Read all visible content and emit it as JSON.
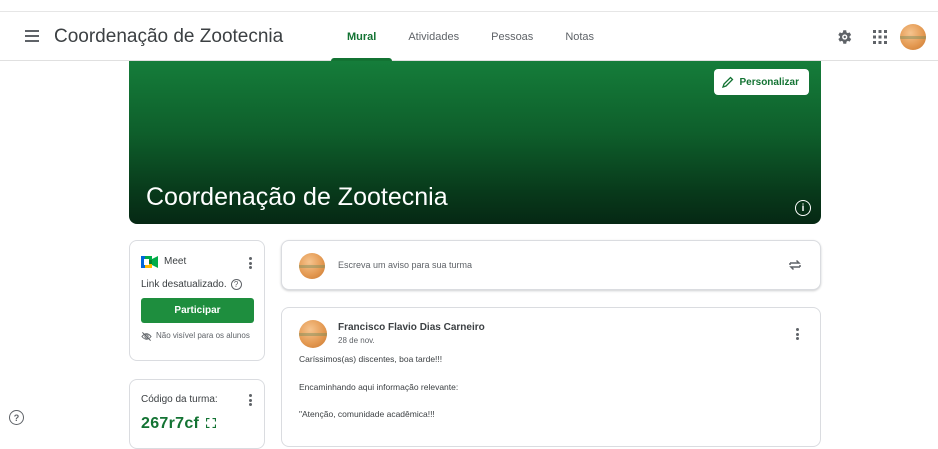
{
  "header": {
    "app_title": "Coordenação de Zootecnia",
    "tabs": [
      {
        "label": "Mural",
        "active": true
      },
      {
        "label": "Atividades",
        "active": false
      },
      {
        "label": "Pessoas",
        "active": false
      },
      {
        "label": "Notas",
        "active": false
      }
    ],
    "icons": [
      "menu-icon",
      "settings-icon",
      "apps-grid-icon",
      "account-avatar"
    ]
  },
  "banner": {
    "title": "Coordenação de Zootecnia",
    "customize_label": "Personalizar",
    "info_glyph": "i"
  },
  "meet": {
    "label": "Meet",
    "link_status": "Link desatualizado.",
    "join_label": "Participar",
    "visibility_note": "Não visível para os alunos"
  },
  "class_code": {
    "label": "Código da turma:",
    "value": "267r7cf"
  },
  "announce": {
    "placeholder": "Escreva um aviso para sua turma"
  },
  "post": {
    "author": "Francisco Flavio Dias Carneiro",
    "date": "28 de nov.",
    "lines": [
      "Caríssimos(as) discentes, boa tarde!!!",
      "Encaminhando aqui informação relevante:",
      "\"Atenção, comunidade acadêmica!!!"
    ]
  },
  "colors": {
    "accent_green": "#137333",
    "button_green": "#1e8e3e",
    "banner_green": "#0e5e2b"
  },
  "help_glyph": "?"
}
